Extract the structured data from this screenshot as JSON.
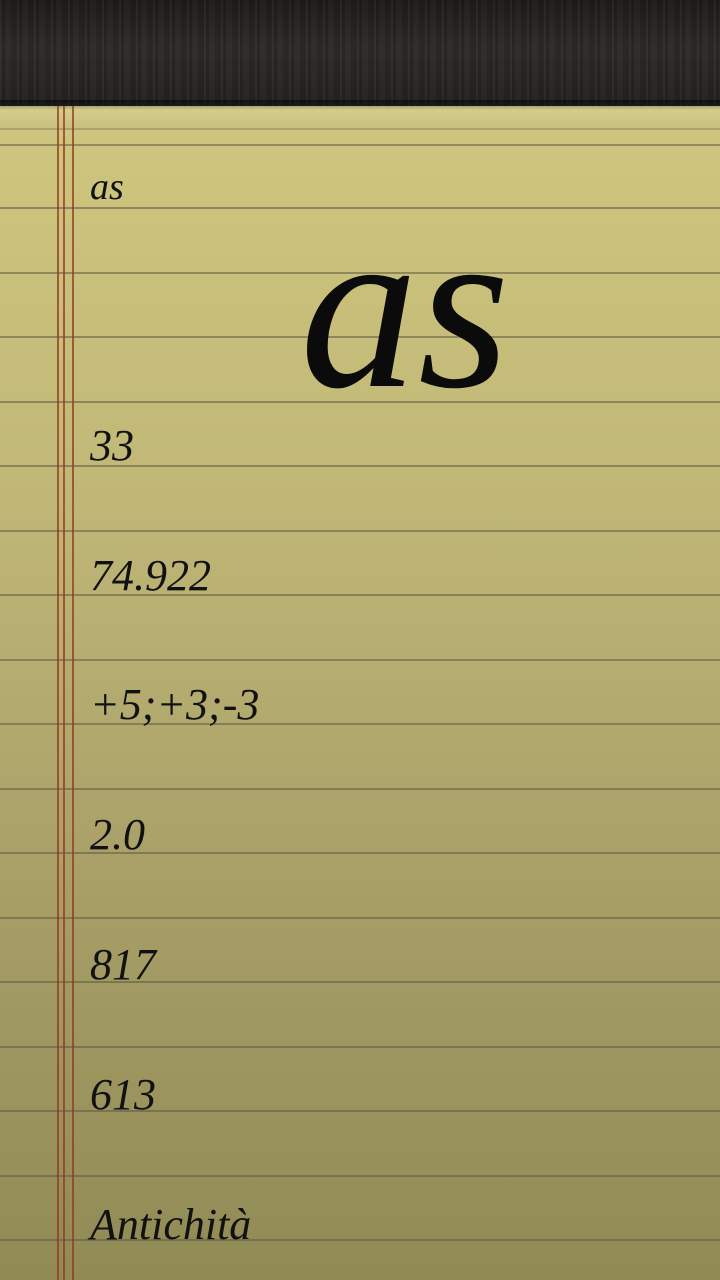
{
  "note": {
    "small_symbol": "as",
    "big_symbol": "as",
    "fields": [
      {
        "key": "atomic_number",
        "value": "33"
      },
      {
        "key": "atomic_mass",
        "value": "74.922"
      },
      {
        "key": "oxidation_states",
        "value": "+5;+3;-3"
      },
      {
        "key": "electronegativity",
        "value": "2.0"
      },
      {
        "key": "melting_point",
        "value": "817"
      },
      {
        "key": "boiling_point",
        "value": "613"
      },
      {
        "key": "discovery",
        "value": "Antichità"
      }
    ]
  },
  "colors": {
    "paper_top": "#cfc67e",
    "paper_bottom": "#908a55",
    "margin_line": "#96371e",
    "ink": "#111111",
    "wood": "#24221f"
  }
}
